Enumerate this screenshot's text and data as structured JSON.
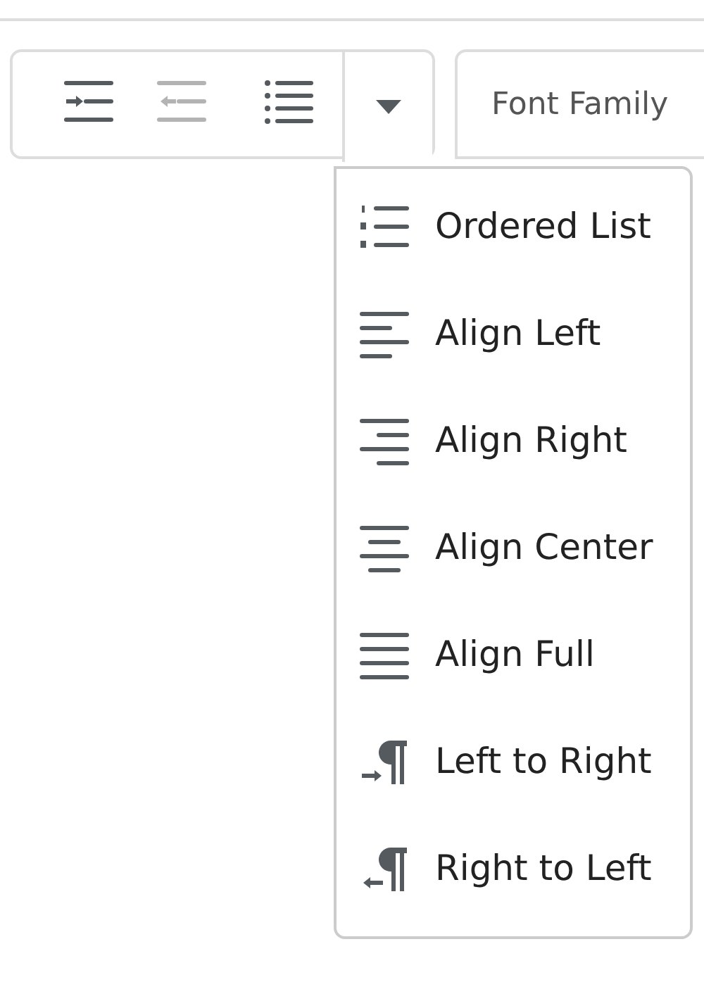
{
  "toolbar": {
    "buttons": [
      {
        "kind": "indent",
        "disabled": false
      },
      {
        "kind": "outdent",
        "disabled": true
      },
      {
        "kind": "bullist",
        "disabled": false
      }
    ],
    "more_button": {
      "expanded": true
    }
  },
  "font_family": {
    "label": "Font Family"
  },
  "menu": {
    "items": [
      {
        "kind": "numlist",
        "label": "Ordered List"
      },
      {
        "kind": "alignleft",
        "label": "Align Left"
      },
      {
        "kind": "alignright",
        "label": "Align Right"
      },
      {
        "kind": "aligncenter",
        "label": "Align Center"
      },
      {
        "kind": "alignjustify",
        "label": "Align Full"
      },
      {
        "kind": "ltr",
        "label": "Left to Right"
      },
      {
        "kind": "rtl",
        "label": "Right to Left"
      }
    ]
  }
}
